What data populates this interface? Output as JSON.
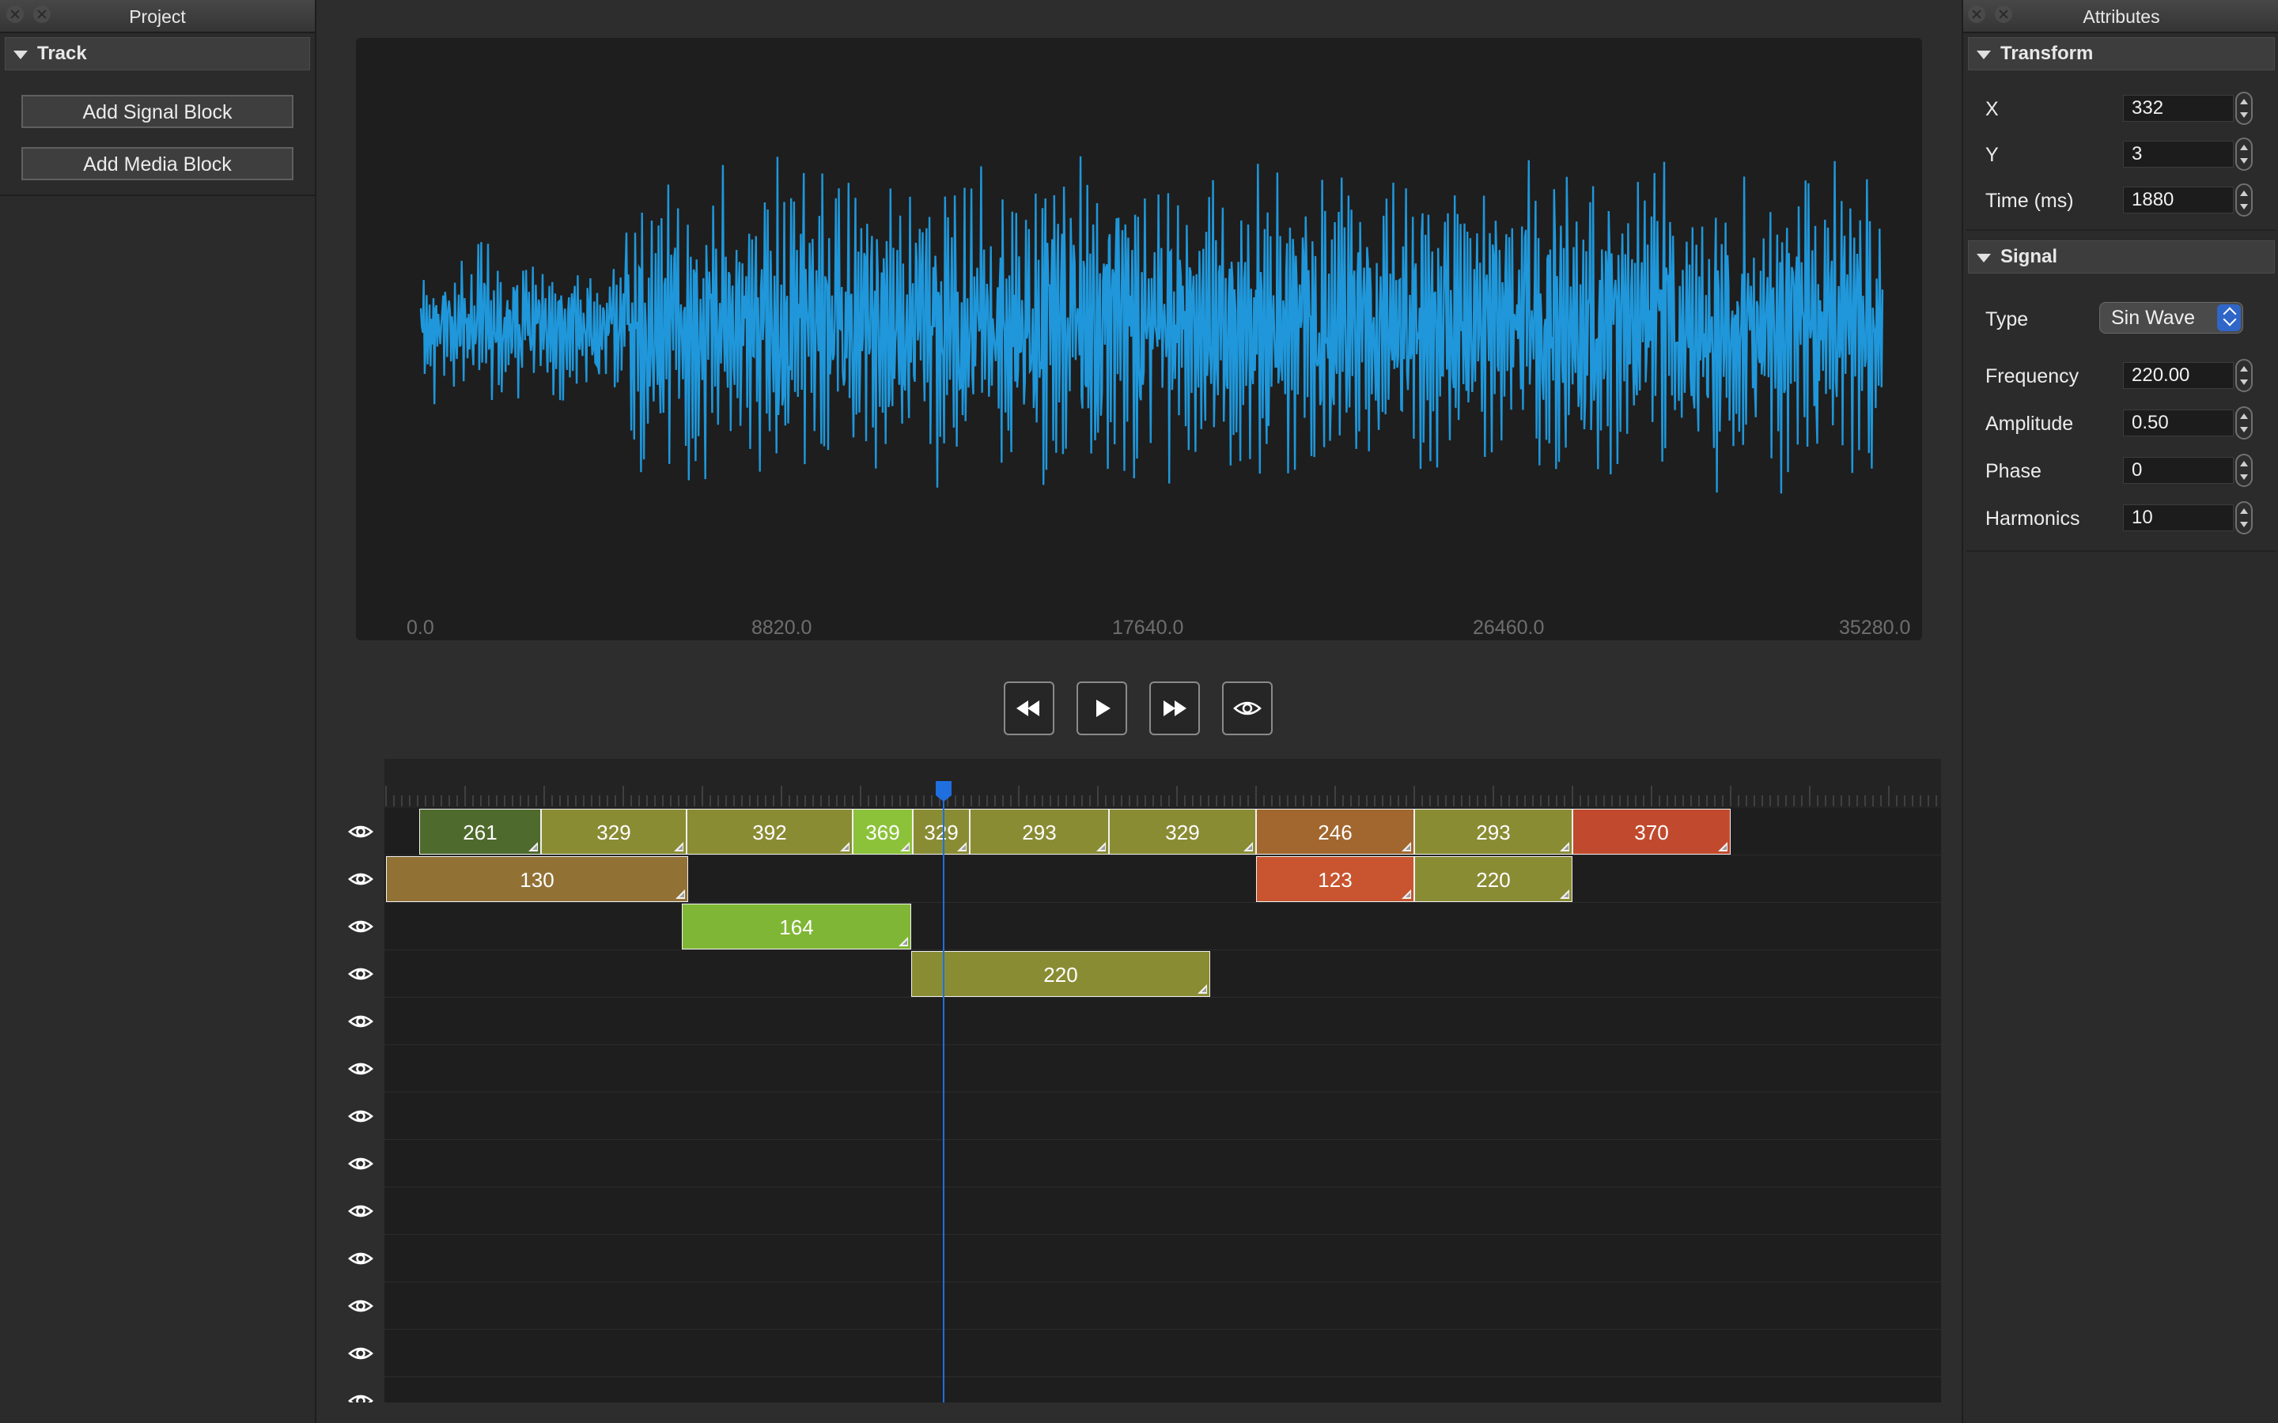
{
  "left_panel": {
    "title": "Project",
    "section": "Track",
    "buttons": [
      "Add Signal Block",
      "Add Media Block"
    ]
  },
  "right_panel": {
    "title": "Attributes",
    "transform": {
      "header": "Transform",
      "x_label": "X",
      "x_value": "332",
      "y_label": "Y",
      "y_value": "3",
      "time_label": "Time (ms)",
      "time_value": "1880"
    },
    "signal": {
      "header": "Signal",
      "type_label": "Type",
      "type_value": "Sin Wave",
      "frequency_label": "Frequency",
      "frequency_value": "220.00",
      "amplitude_label": "Amplitude",
      "amplitude_value": "0.50",
      "phase_label": "Phase",
      "phase_value": "0",
      "harmonics_label": "Harmonics",
      "harmonics_value": "10"
    }
  },
  "waveform": {
    "x_ticks": [
      "0.0",
      "8820.0",
      "17640.0",
      "26460.0",
      "35280.0"
    ],
    "line_color": "#1f97da"
  },
  "transport": {
    "icons": [
      "rewind-icon",
      "play-icon",
      "fast-forward-icon",
      "eye-icon"
    ]
  },
  "timeline": {
    "playhead_color": "#1f6fe0",
    "tracks": [
      [
        {
          "label": "261",
          "color": "#4e6a2c"
        },
        {
          "label": "329",
          "color": "#8a8c34"
        },
        {
          "label": "392",
          "color": "#8a8c34"
        },
        {
          "label": "369",
          "color": "#8cc23a"
        },
        {
          "label": "329",
          "color": "#8a8c34"
        },
        {
          "label": "293",
          "color": "#8a8c34"
        },
        {
          "label": "329",
          "color": "#8a8c34"
        },
        {
          "label": "246",
          "color": "#a2672e"
        },
        {
          "label": "293",
          "color": "#8a8c34"
        },
        {
          "label": "370",
          "color": "#c14a2e"
        }
      ],
      [
        {
          "label": "130",
          "color": "#927135"
        },
        {
          "label": "123",
          "color": "#c8552f"
        },
        {
          "label": "220",
          "color": "#8a8c34"
        }
      ],
      [
        {
          "label": "164",
          "color": "#80b635"
        }
      ],
      [
        {
          "label": "220",
          "color": "#8a8c34"
        }
      ]
    ]
  }
}
